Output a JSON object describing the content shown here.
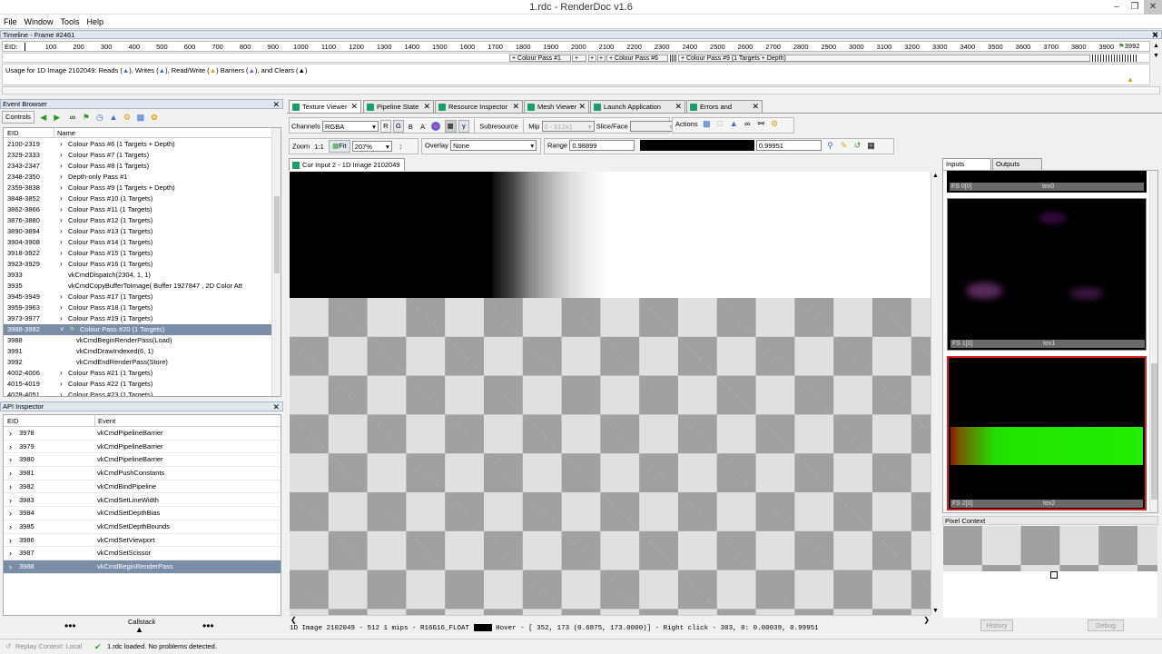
{
  "window": {
    "title": "1.rdc - RenderDoc v1.6"
  },
  "menu": [
    "File",
    "Window",
    "Tools",
    "Help"
  ],
  "timeline": {
    "title": "Timeline - Frame #2461",
    "eid_label": "EID:",
    "ticks": [
      "100",
      "200",
      "300",
      "400",
      "500",
      "600",
      "700",
      "800",
      "900",
      "1000",
      "1100",
      "1200",
      "1300",
      "1400",
      "1500",
      "1600",
      "1700",
      "1800",
      "1900",
      "2000",
      "2100",
      "2200",
      "2300",
      "2400",
      "2500",
      "2600",
      "2700",
      "2800",
      "2900",
      "3000",
      "3100",
      "3200",
      "3300",
      "3400",
      "3500",
      "3600",
      "3700",
      "3800",
      "3900"
    ],
    "current": "3992",
    "passes": [
      "Colour Pass #1",
      "+",
      "+",
      "+",
      "Colour Pass #6",
      "Colour Pass #9 (1 Targets + Depth)"
    ],
    "usage_prefix": "Usage for 1D Image 2102049: Reads (",
    "usage_writes": "), Writes (",
    "usage_rw": "), Read/Write (",
    "usage_barriers": ") Barriers (",
    "usage_clears": "), and Clears (",
    "usage_end": ")"
  },
  "event_browser": {
    "title": "Event Browser",
    "controls_label": "Controls",
    "col_eid": "EID",
    "col_name": "Name",
    "rows": [
      {
        "eid": "2100-2319",
        "name": "Colour Pass #6 (1 Targets + Depth)",
        "indent": 0
      },
      {
        "eid": "2329-2333",
        "name": "Colour Pass #7 (1 Targets)",
        "indent": 0
      },
      {
        "eid": "2343-2347",
        "name": "Colour Pass #8 (1 Targets)",
        "indent": 0
      },
      {
        "eid": "2348-2350",
        "name": "Depth-only Pass #1",
        "indent": 0
      },
      {
        "eid": "2359-3838",
        "name": "Colour Pass #9 (1 Targets + Depth)",
        "indent": 0
      },
      {
        "eid": "3848-3852",
        "name": "Colour Pass #10 (1 Targets)",
        "indent": 0
      },
      {
        "eid": "3862-3866",
        "name": "Colour Pass #11 (1 Targets)",
        "indent": 0
      },
      {
        "eid": "3876-3880",
        "name": "Colour Pass #12 (1 Targets)",
        "indent": 0
      },
      {
        "eid": "3890-3894",
        "name": "Colour Pass #13 (1 Targets)",
        "indent": 0
      },
      {
        "eid": "3904-3908",
        "name": "Colour Pass #14 (1 Targets)",
        "indent": 0
      },
      {
        "eid": "3918-3922",
        "name": "Colour Pass #15 (1 Targets)",
        "indent": 0
      },
      {
        "eid": "3923-3929",
        "name": "Colour Pass #16 (1 Targets)",
        "indent": 0
      },
      {
        "eid": "3933",
        "name": "vkCmdDispatch(2304, 1, 1)",
        "indent": 1
      },
      {
        "eid": "3935",
        "name": "vkCmdCopyBufferToImage( Buffer 1927847 , 2D Color Att",
        "indent": 1
      },
      {
        "eid": "3945-3949",
        "name": "Colour Pass #17 (1 Targets)",
        "indent": 0
      },
      {
        "eid": "3959-3963",
        "name": "Colour Pass #18 (1 Targets)",
        "indent": 0
      },
      {
        "eid": "3973-3977",
        "name": "Colour Pass #19 (1 Targets)",
        "indent": 0
      },
      {
        "eid": "3988-3992",
        "name": "Colour Pass #20 (1 Targets)",
        "indent": 0,
        "selected": true
      },
      {
        "eid": "3988",
        "name": "vkCmdBeginRenderPass(Load)",
        "indent": 2
      },
      {
        "eid": "3991",
        "name": "vkCmdDrawIndexed(6, 1)",
        "indent": 2
      },
      {
        "eid": "3992",
        "name": "vkCmdEndRenderPass(Store)",
        "indent": 2
      },
      {
        "eid": "4002-4006",
        "name": "Colour Pass #21 (1 Targets)",
        "indent": 0
      },
      {
        "eid": "4015-4019",
        "name": "Colour Pass #22 (1 Targets)",
        "indent": 0
      },
      {
        "eid": "4028-4051",
        "name": "Colour Pass #23 (1 Targets)",
        "indent": 0
      }
    ]
  },
  "api_inspector": {
    "title": "API Inspector",
    "col_eid": "EID",
    "col_event": "Event",
    "rows": [
      {
        "eid": "3978",
        "event": "vkCmdPipelineBarrier"
      },
      {
        "eid": "3979",
        "event": "vkCmdPipelineBarrier"
      },
      {
        "eid": "3980",
        "event": "vkCmdPipelineBarrier"
      },
      {
        "eid": "3981",
        "event": "vkCmdPushConstants"
      },
      {
        "eid": "3982",
        "event": "vkCmdBindPipeline"
      },
      {
        "eid": "3983",
        "event": "vkCmdSetLineWidth"
      },
      {
        "eid": "3984",
        "event": "vkCmdSetDepthBias"
      },
      {
        "eid": "3985",
        "event": "vkCmdSetDepthBounds"
      },
      {
        "eid": "3986",
        "event": "vkCmdSetViewport"
      },
      {
        "eid": "3987",
        "event": "vkCmdSetScissor"
      },
      {
        "eid": "3988",
        "event": "vkCmdBeginRenderPass",
        "selected": true
      }
    ],
    "callstack_label": "Callstack"
  },
  "tabs": [
    {
      "label": "Texture Viewer",
      "active": true
    },
    {
      "label": "Pipeline State"
    },
    {
      "label": "Resource Inspector"
    },
    {
      "label": "Mesh Viewer"
    },
    {
      "label": "Launch Application"
    },
    {
      "label": "Errors and Warnings"
    }
  ],
  "texture_toolbar": {
    "channels_label": "Channels",
    "channels_value": "RGBA",
    "ch_r": "R",
    "ch_g": "G",
    "ch_b": "B",
    "ch_a": "A",
    "gamma": "γ",
    "subresource_label": "Subresource",
    "mip_label": "Mip",
    "mip_value": "0 - 512x1",
    "slice_label": "Slice/Face",
    "actions_label": "Actions",
    "zoom_label": "Zoom",
    "zoom_11": "1:1",
    "fit_label": "Fit",
    "zoom_value": "207%",
    "overlay_label": "Overlay",
    "overlay_value": "None",
    "range_label": "Range",
    "range_min": "0.98899",
    "range_max": "0.99951"
  },
  "texture_tab": {
    "label": "Cur Input 2 - 1D Image 2102049"
  },
  "status_line": {
    "text1": "1D Image 2102049 - 512 1 mips - R16G16_FLOAT",
    "text2": "Hover - [ 352,  173 (0.6875, 173.0000)] - Right click -  303,     0: 0.00039, 0.99951"
  },
  "thumbs": {
    "tab_inputs": "Inputs",
    "tab_outputs": "Outputs",
    "items": [
      {
        "slot": "FS 0[0]",
        "name": "tex0"
      },
      {
        "slot": "FS 1[0]",
        "name": "tex1"
      },
      {
        "slot": "FS 2[0]",
        "name": "tex2"
      }
    ]
  },
  "pixel_context": {
    "title": "Pixel Context",
    "history": "History",
    "debug": "Debug"
  },
  "statusbar": {
    "replay": "Replay Context: Local",
    "message": "1.rdc loaded. No problems detected."
  },
  "colors": {
    "selection": "#7b8ca6",
    "accent_green": "#1a9f6a",
    "thumb_highlight": "#e02020"
  }
}
